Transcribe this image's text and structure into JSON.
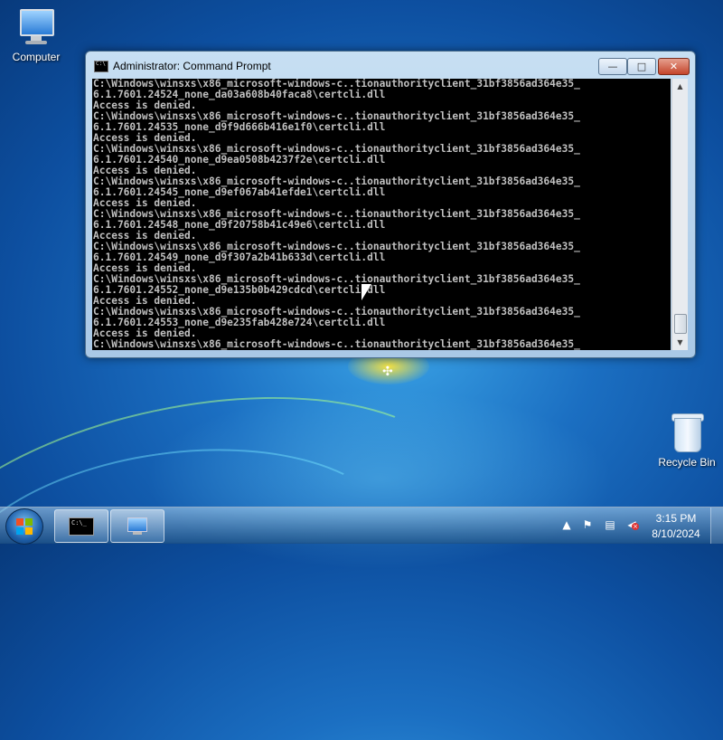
{
  "desktop": {
    "icons": [
      {
        "label": "Computer",
        "icon": "computer-icon"
      },
      {
        "label": "Recycle Bin",
        "icon": "recycle-bin-icon"
      }
    ]
  },
  "window": {
    "title": "Administrator: Command Prompt",
    "minimize_glyph": "—",
    "maximize_glyph": "□",
    "close_glyph": "✕",
    "console_lines": [
      "C:\\Windows\\winsxs\\x86_microsoft-windows-c..tionauthorityclient_31bf3856ad364e35_",
      "6.1.7601.24524_none_da03a608b40faca8\\certcli.dll",
      "Access is denied.",
      "C:\\Windows\\winsxs\\x86_microsoft-windows-c..tionauthorityclient_31bf3856ad364e35_",
      "6.1.7601.24535_none_d9f9d666b416e1f0\\certcli.dll",
      "Access is denied.",
      "C:\\Windows\\winsxs\\x86_microsoft-windows-c..tionauthorityclient_31bf3856ad364e35_",
      "6.1.7601.24540_none_d9ea0508b4237f2e\\certcli.dll",
      "Access is denied.",
      "C:\\Windows\\winsxs\\x86_microsoft-windows-c..tionauthorityclient_31bf3856ad364e35_",
      "6.1.7601.24545_none_d9ef067ab41efde1\\certcli.dll",
      "Access is denied.",
      "C:\\Windows\\winsxs\\x86_microsoft-windows-c..tionauthorityclient_31bf3856ad364e35_",
      "6.1.7601.24548_none_d9f20758b41c49e6\\certcli.dll",
      "Access is denied.",
      "C:\\Windows\\winsxs\\x86_microsoft-windows-c..tionauthorityclient_31bf3856ad364e35_",
      "6.1.7601.24549_none_d9f307a2b41b633d\\certcli.dll",
      "Access is denied.",
      "C:\\Windows\\winsxs\\x86_microsoft-windows-c..tionauthorityclient_31bf3856ad364e35_",
      "6.1.7601.24552_none_d9e135b0b429cdcd\\certcli.dll",
      "Access is denied.",
      "C:\\Windows\\winsxs\\x86_microsoft-windows-c..tionauthorityclient_31bf3856ad364e35_",
      "6.1.7601.24553_none_d9e235fab428e724\\certcli.dll",
      "Access is denied.",
      "C:\\Windows\\winsxs\\x86_microsoft-windows-c..tionauthorityclient_31bf3856ad364e35_"
    ]
  },
  "taskbar": {
    "buttons": [
      {
        "name": "command-prompt",
        "icon": "command-prompt-icon"
      },
      {
        "name": "remote-desktop",
        "icon": "computer-icon"
      }
    ],
    "tray": {
      "show_hidden_glyph": "▲",
      "icons": [
        "action-center-flag-icon",
        "network-icon",
        "volume-muted-icon"
      ]
    },
    "clock": {
      "time": "3:15 PM",
      "date": "8/10/2024"
    }
  },
  "colors": {
    "console_bg": "#000000",
    "console_fg": "#c0c0c0",
    "close_button": "#c4452b",
    "desktop": "#1b6fc2"
  }
}
